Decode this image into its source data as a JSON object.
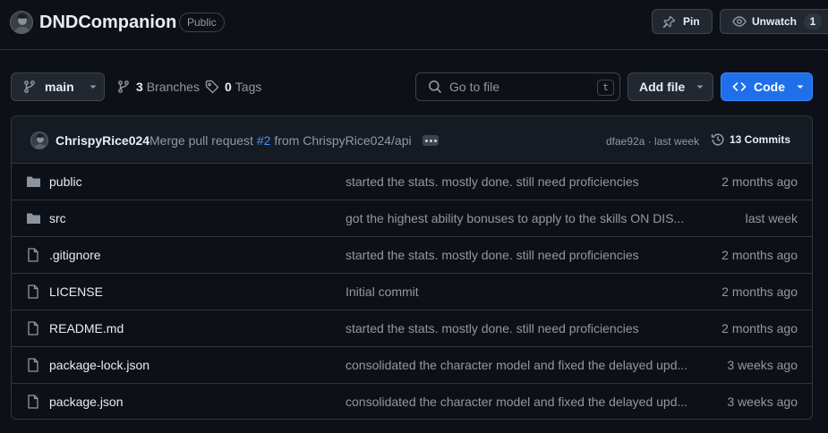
{
  "repo": {
    "name": "DNDCompanion",
    "visibility": "Public",
    "pin_label": "Pin",
    "watch_label": "Unwatch",
    "watch_count": "1"
  },
  "toolbar": {
    "branch": "main",
    "branches_count": "3",
    "branches_label": "Branches",
    "tags_count": "0",
    "tags_label": "Tags",
    "search_placeholder": "Go to file",
    "search_shortcut": "t",
    "add_file_label": "Add file",
    "code_label": "Code"
  },
  "latest_commit": {
    "author": "ChrispyRice024",
    "message_prefix": "Merge pull request",
    "pr_number": "#2",
    "message_suffix": "from ChrispyRice024/api",
    "hash_and_time": "dfae92a · last week",
    "commits_count": "13 Commits"
  },
  "files": [
    {
      "name": "public",
      "type": "folder",
      "message": "started the stats. mostly done. still need proficiencies",
      "age": "2 months ago"
    },
    {
      "name": "src",
      "type": "folder",
      "message": "got the highest ability bonuses to apply to the skills ON DIS...",
      "age": "last week"
    },
    {
      "name": ".gitignore",
      "type": "file",
      "message": "started the stats. mostly done. still need proficiencies",
      "age": "2 months ago"
    },
    {
      "name": "LICENSE",
      "type": "file",
      "message": "Initial commit",
      "age": "2 months ago"
    },
    {
      "name": "README.md",
      "type": "file",
      "message": "started the stats. mostly done. still need proficiencies",
      "age": "2 months ago"
    },
    {
      "name": "package-lock.json",
      "type": "file",
      "message": "consolidated the character model and fixed the delayed upd...",
      "age": "3 weeks ago"
    },
    {
      "name": "package.json",
      "type": "file",
      "message": "consolidated the character model and fixed the delayed upd...",
      "age": "3 weeks ago"
    }
  ],
  "colors": {
    "background": "#0d1117",
    "accent": "#1f6feb",
    "link": "#4493f8",
    "muted_text": "#9198a1",
    "border": "#30363d"
  },
  "icons": {
    "branch": "git-branch-icon",
    "tag": "tag-icon",
    "search": "search-icon",
    "code": "code-icon",
    "pin": "pin-icon",
    "eye": "eye-icon",
    "history": "history-icon",
    "folder": "folder-icon",
    "file": "file-icon"
  }
}
